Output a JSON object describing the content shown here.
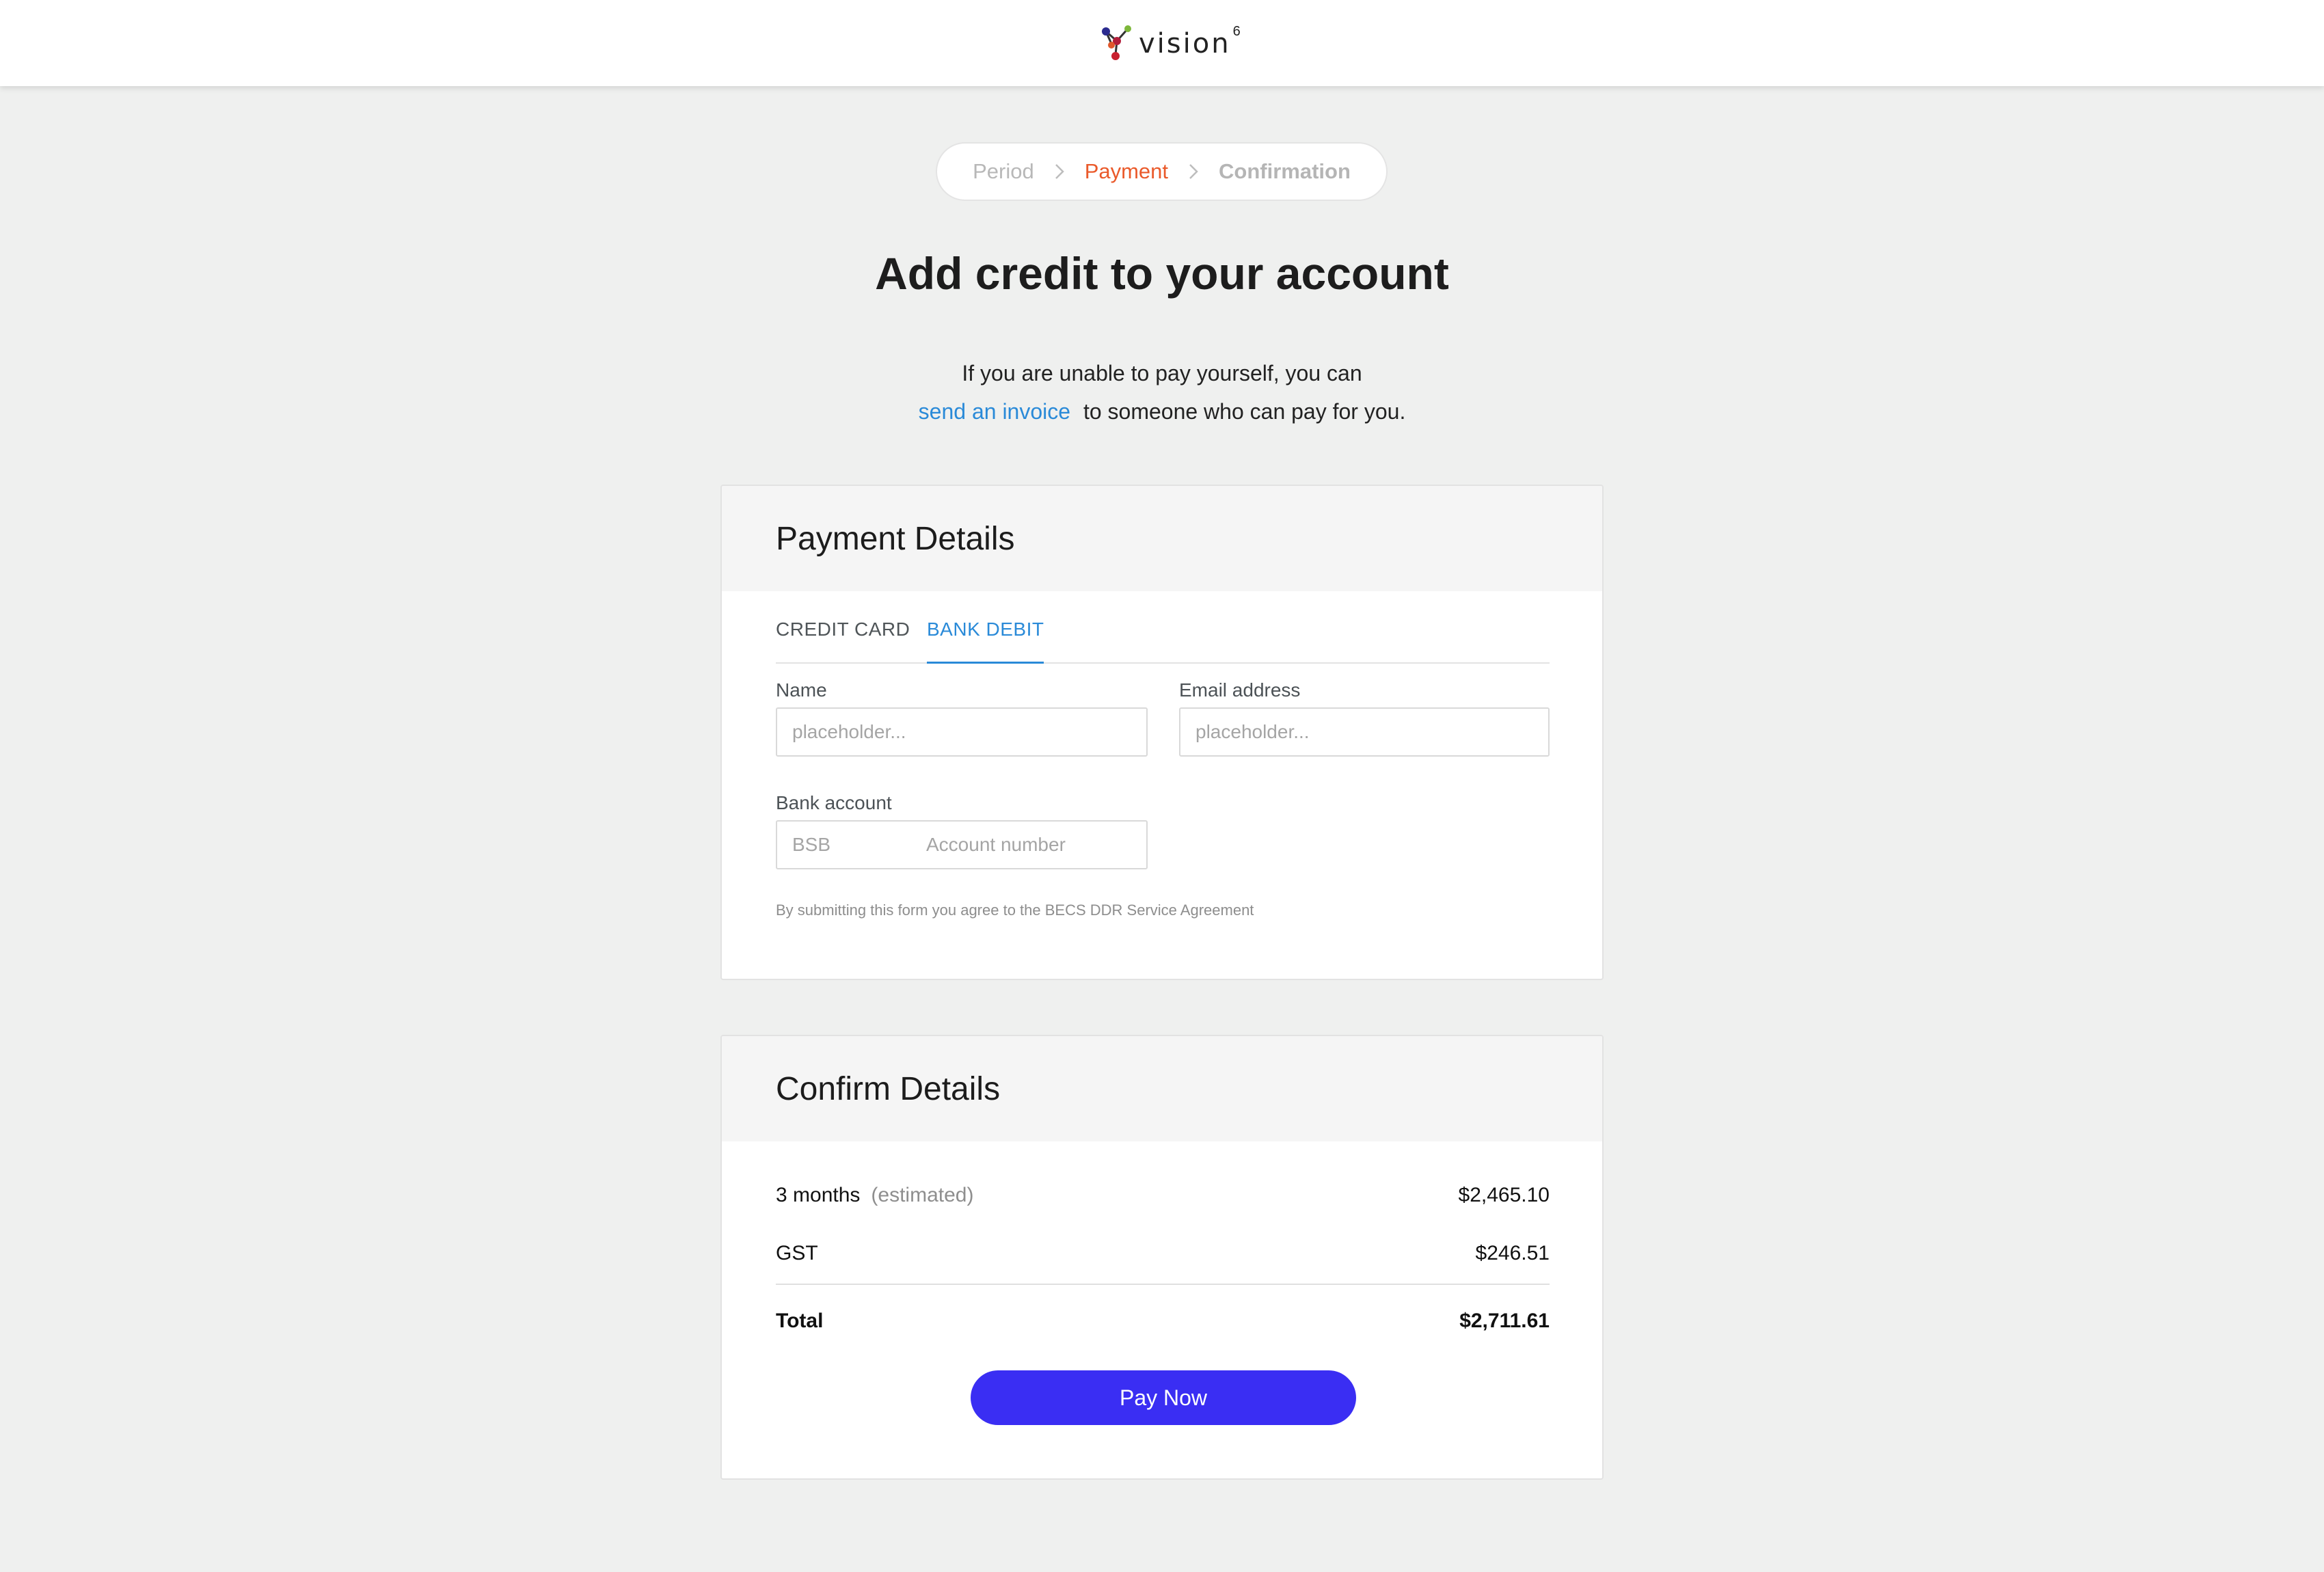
{
  "header": {
    "brand": "vision",
    "brand_sup": "6"
  },
  "stepper": {
    "steps": [
      "Period",
      "Payment",
      "Confirmation"
    ],
    "active_index": 1
  },
  "page": {
    "title": "Add credit to your account",
    "subtitle_line1": "If you are unable to pay yourself, you can",
    "invoice_link": "send an invoice",
    "subtitle_line2": "to someone who can pay for you."
  },
  "payment_details": {
    "heading": "Payment Details",
    "tabs": [
      "CREDIT CARD",
      "BANK DEBIT"
    ],
    "active_tab": "BANK DEBIT",
    "name_label": "Name",
    "name_placeholder": "placeholder...",
    "email_label": "Email address",
    "email_placeholder": "placeholder...",
    "bank_label": "Bank account",
    "bsb_placeholder": "BSB",
    "account_placeholder": "Account number",
    "agreement": "By submitting this form you agree to the BECS DDR Service Agreement"
  },
  "confirm_details": {
    "heading": "Confirm Details",
    "period_label": "3 months",
    "period_note": "(estimated)",
    "period_amount": "$2,465.10",
    "gst_label": "GST",
    "gst_amount": "$246.51",
    "total_label": "Total",
    "total_amount": "$2,711.61",
    "pay_button": "Pay Now"
  },
  "colors": {
    "accent_orange": "#ea5a2b",
    "link_blue": "#2a8ad8",
    "pay_button": "#3a2ef3",
    "background": "#eff0ef"
  }
}
